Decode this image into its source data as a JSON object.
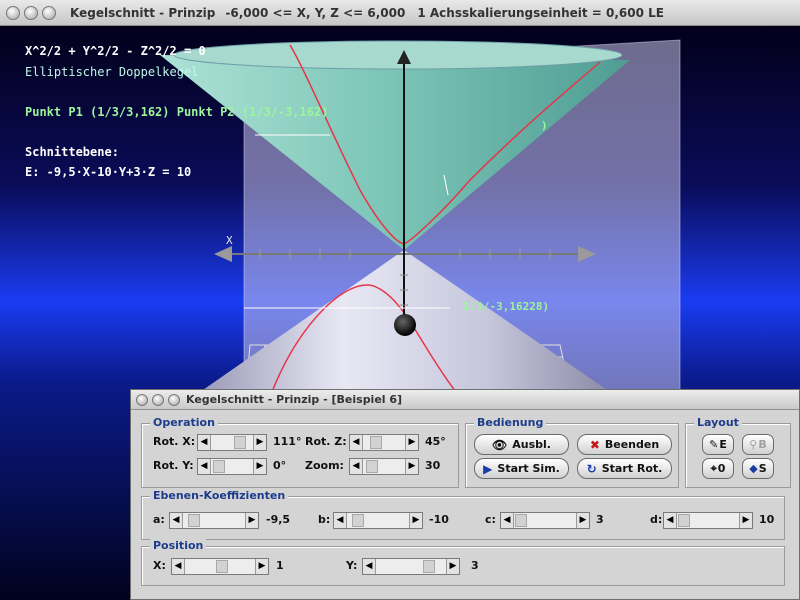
{
  "main_window": {
    "title": "Kegelschnitt - Prinzip",
    "range_info": "-6,000 <= X, Y, Z <= 6,000",
    "scale_info": "1 Achsskalierungseinheit = 0,600 LE"
  },
  "overlay": {
    "equation": "X^2/2 + Y^2/2 - Z^2/2 = 0",
    "surface_name": "Elliptischer Doppelkegel",
    "points": "Punkt P1 (1/3/3,162)  Punkt P2 (1/3/-3,162)",
    "plane_title": "Schnittebene:",
    "plane_equation": "E: -9,5·X-10·Y+3·Z = 10",
    "axis_x_label": "X",
    "point_label_upper": ")",
    "point_label_lower": "1/3/-3,16228)"
  },
  "dialog": {
    "title": "Kegelschnitt - Prinzip - [Beispiel 6]",
    "operation": {
      "title": "Operation",
      "rot_x_label": "Rot. X:",
      "rot_x_value": "111°",
      "rot_y_label": "Rot. Y:",
      "rot_y_value": "0°",
      "rot_z_label": "Rot. Z:",
      "rot_z_value": "45°",
      "zoom_label": "Zoom:",
      "zoom_value": "30"
    },
    "bedienung": {
      "title": "Bedienung",
      "ausbl": "Ausbl.",
      "beenden": "Beenden",
      "start_sim": "Start Sim.",
      "start_rot": "Start Rot."
    },
    "layout": {
      "title": "Layout",
      "btn_e": "E",
      "btn_b": "B",
      "btn_0": "0",
      "btn_s": "S"
    },
    "ebenen": {
      "title": "Ebenen-Koeffizienten",
      "a_label": "a:",
      "a_value": "-9,5",
      "b_label": "b:",
      "b_value": "-10",
      "c_label": "c:",
      "c_value": "3",
      "d_label": "d:",
      "d_value": "10"
    },
    "position": {
      "title": "Position",
      "x_label": "X:",
      "x_value": "1",
      "y_label": "Y:",
      "y_value": "3"
    }
  },
  "icons": {
    "window_buttons": [
      "window-menu-icon",
      "minimize-icon",
      "maximize-icon"
    ],
    "ausbl": "eye-icon",
    "beenden": "x-cross-icon",
    "start_sim": "play-icon",
    "start_rot": "rotate-icon",
    "layout_e": "brush-icon",
    "layout_b": "torch-icon",
    "layout_0": "crosshair-icon",
    "layout_s": "eraser-icon"
  }
}
